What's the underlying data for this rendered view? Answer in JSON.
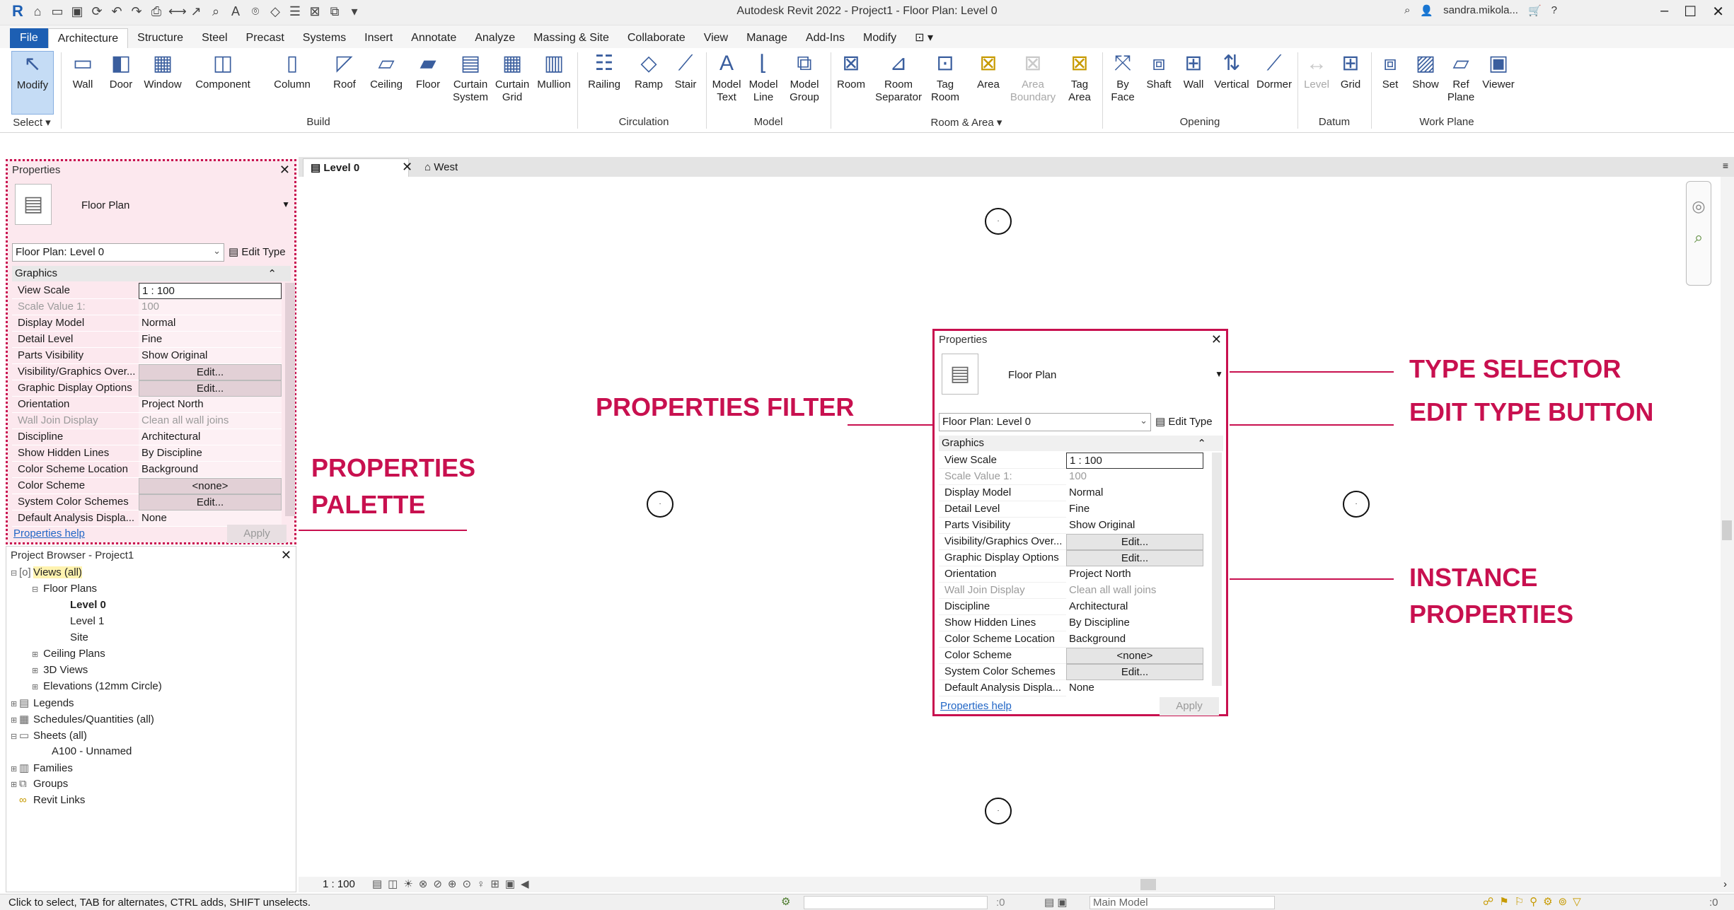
{
  "title_bar": {
    "app_title": "Autodesk Revit 2022 - Project1 - Floor Plan: Level 0",
    "user": "sandra.mikola...",
    "help_icon": "?"
  },
  "menu_tabs": [
    "File",
    "Architecture",
    "Structure",
    "Steel",
    "Precast",
    "Systems",
    "Insert",
    "Annotate",
    "Analyze",
    "Massing & Site",
    "Collaborate",
    "View",
    "Manage",
    "Add-Ins",
    "Modify"
  ],
  "ribbon": {
    "modify": "Modify",
    "select": "Select",
    "build": {
      "label": "Build",
      "buttons": [
        "Wall",
        "Door",
        "Window",
        "Component",
        "Column",
        "Roof",
        "Ceiling",
        "Floor",
        "Curtain\nSystem",
        "Curtain\nGrid",
        "Mullion"
      ]
    },
    "circulation": {
      "label": "Circulation",
      "buttons": [
        "Railing",
        "Ramp",
        "Stair"
      ]
    },
    "model": {
      "label": "Model",
      "buttons": [
        "Model\nText",
        "Model\nLine",
        "Model\nGroup"
      ]
    },
    "room_area": {
      "label": "Room & Area",
      "buttons": [
        "Room",
        "Room\nSeparator",
        "Tag\nRoom",
        "Area",
        "Area\nBoundary",
        "Tag\nArea"
      ]
    },
    "opening": {
      "label": "Opening",
      "buttons": [
        "By\nFace",
        "Shaft",
        "Wall",
        "Vertical",
        "Dormer"
      ]
    },
    "datum": {
      "label": "Datum",
      "buttons": [
        "Level",
        "Grid"
      ]
    },
    "work_plane": {
      "label": "Work Plane",
      "buttons": [
        "Set",
        "Show",
        "Ref\nPlane",
        "Viewer"
      ]
    }
  },
  "properties": {
    "title": "Properties",
    "type_name": "Floor Plan",
    "filter_value": "Floor Plan: Level 0",
    "edit_type": "Edit Type",
    "group": "Graphics",
    "rows": [
      {
        "k": "View Scale",
        "v": "1 : 100"
      },
      {
        "k": "Scale Value    1:",
        "v": "100"
      },
      {
        "k": "Display Model",
        "v": "Normal"
      },
      {
        "k": "Detail Level",
        "v": "Fine"
      },
      {
        "k": "Parts Visibility",
        "v": "Show Original"
      },
      {
        "k": "Visibility/Graphics Over...",
        "v": "Edit..."
      },
      {
        "k": "Graphic Display Options",
        "v": "Edit..."
      },
      {
        "k": "Orientation",
        "v": "Project North"
      },
      {
        "k": "Wall Join Display",
        "v": "Clean all wall joins"
      },
      {
        "k": "Discipline",
        "v": "Architectural"
      },
      {
        "k": "Show Hidden Lines",
        "v": "By Discipline"
      },
      {
        "k": "Color Scheme Location",
        "v": "Background"
      },
      {
        "k": "Color Scheme",
        "v": "<none>"
      },
      {
        "k": "System Color Schemes",
        "v": "Edit..."
      },
      {
        "k": "Default Analysis Displa...",
        "v": "None"
      }
    ],
    "help": "Properties help",
    "apply": "Apply"
  },
  "browser": {
    "title": "Project Browser - Project1",
    "items": [
      {
        "t": "Views (all)",
        "lvl": 0,
        "toggle": "⊟",
        "bold": false,
        "hl": true
      },
      {
        "t": "Floor Plans",
        "lvl": 1,
        "toggle": "⊟"
      },
      {
        "t": "Level 0",
        "lvl": 2,
        "toggle": "",
        "bold": true
      },
      {
        "t": "Level 1",
        "lvl": 2,
        "toggle": ""
      },
      {
        "t": "Site",
        "lvl": 2,
        "toggle": ""
      },
      {
        "t": "Ceiling Plans",
        "lvl": 1,
        "toggle": "⊞"
      },
      {
        "t": "3D Views",
        "lvl": 1,
        "toggle": "⊞"
      },
      {
        "t": "Elevations (12mm Circle)",
        "lvl": 1,
        "toggle": "⊞"
      },
      {
        "t": "Legends",
        "lvl": 0,
        "toggle": "⊞"
      },
      {
        "t": "Schedules/Quantities (all)",
        "lvl": 0,
        "toggle": "⊞"
      },
      {
        "t": "Sheets (all)",
        "lvl": 0,
        "toggle": "⊟"
      },
      {
        "t": "A100 - Unnamed",
        "lvl": 1,
        "toggle": ""
      },
      {
        "t": "Families",
        "lvl": 0,
        "toggle": "⊞"
      },
      {
        "t": "Groups",
        "lvl": 0,
        "toggle": "⊞"
      },
      {
        "t": "Revit Links",
        "lvl": 0,
        "toggle": ""
      }
    ]
  },
  "view_tabs": [
    "Level 0",
    "West"
  ],
  "annotations": {
    "palette_1": "PROPERTIES",
    "palette_2": "PALETTE",
    "filter": "PROPERTIES FILTER",
    "type_selector": "TYPE SELECTOR",
    "edit_type": "EDIT TYPE BUTTON",
    "instance_1": "INSTANCE",
    "instance_2": "PROPERTIES"
  },
  "view_control": {
    "scale": "1 : 100"
  },
  "status": {
    "message": "Click to select, TAB for alternates, CTRL adds, SHIFT unselects.",
    "model": "Main Model",
    "count": ":0",
    "filter_count": ":0"
  },
  "colors": {
    "accent": "#c8104f",
    "file_tab": "#1d5fb3"
  }
}
